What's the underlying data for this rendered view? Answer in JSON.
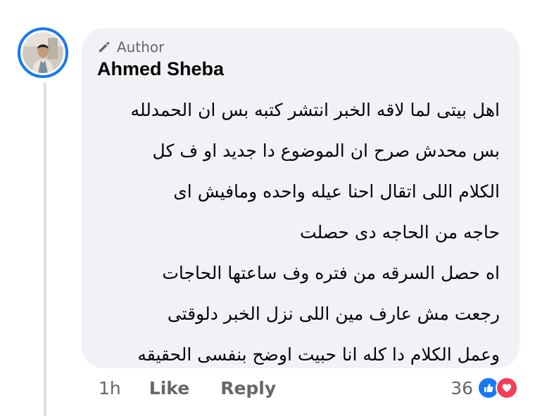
{
  "comment": {
    "badge": "Author",
    "author_name": "Ahmed Sheba",
    "lines": [
      "اهل بيتى لما لاقه الخبر انتشر كتبه بس ان الحمدلله",
      "بس محدش صرح ان الموضوع دا جديد او ف كل",
      "الكلام اللى اتقال احنا عيله واحده ومافيش اى",
      "حاجه من الحاجه دى حصلت",
      "اه حصل السرقه من فتره وف ساعتها الحاجات",
      "رجعت مش عارف مين اللى نزل الخبر دلوقتى",
      "وعمل الكلام دا كله انا حبيت اوضح بنفسى الحقيقه"
    ]
  },
  "actions": {
    "timestamp": "1h",
    "like_label": "Like",
    "reply_label": "Reply"
  },
  "reactions": {
    "count": "36",
    "icons": [
      "like-icon",
      "love-icon"
    ]
  },
  "colors": {
    "bubble": "#f0f2f5",
    "avatar_ring": "#1877f2",
    "like": "#1877f2",
    "love": "#f33e58",
    "secondary_text": "#65676b"
  }
}
